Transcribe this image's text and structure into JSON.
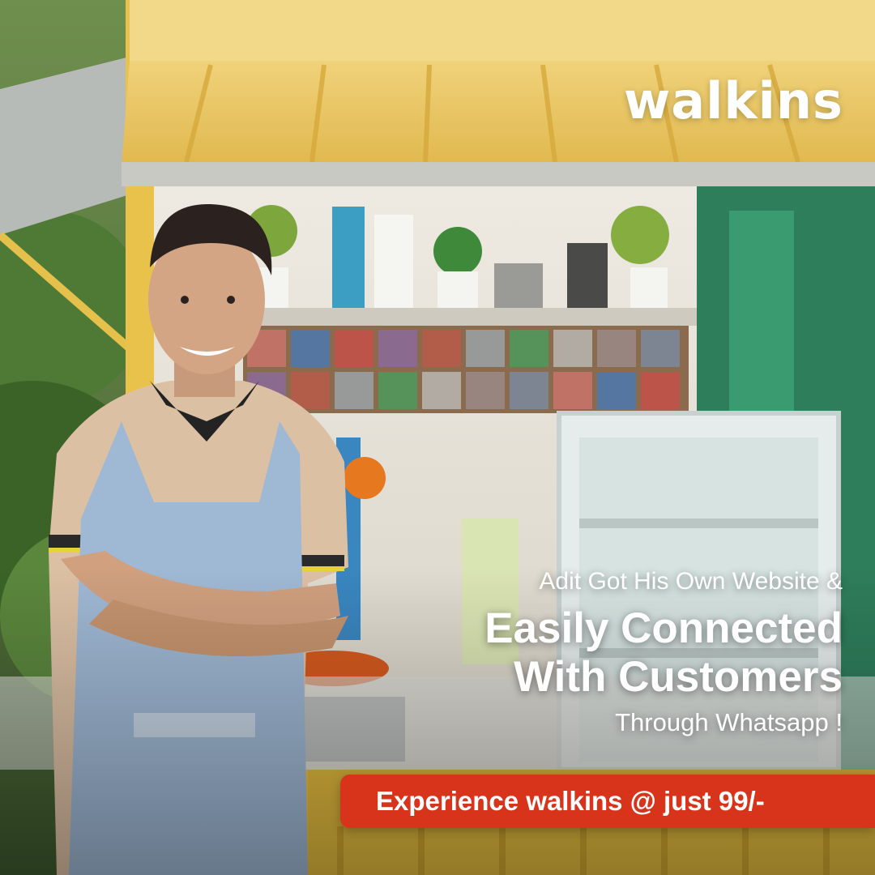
{
  "brand": {
    "logo_text": "walkins"
  },
  "headline": {
    "line1": "Adit Got His Own Website &",
    "line2": "Easily Connected",
    "line3": "With Customers",
    "line4": "Through Whatsapp !"
  },
  "cta": {
    "label": "Experience walkins @ just 99/-"
  },
  "colors": {
    "accent": "#d8341c",
    "text": "#ffffff",
    "kiosk": "#e8c24a"
  },
  "illustration": [
    "food-kiosk",
    "smiling-vendor-in-apron"
  ]
}
